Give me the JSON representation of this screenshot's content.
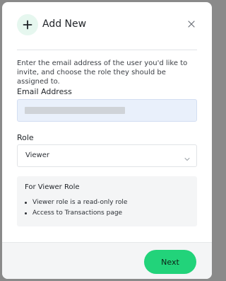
{
  "dialog": {
    "title": "Add New",
    "description": "Enter the email address of the user you'd like to invite, and choose the role they should be assigned to."
  },
  "email": {
    "label": "Email Address",
    "value": ""
  },
  "role": {
    "label": "Role",
    "selected": "Viewer"
  },
  "info": {
    "title": "For Viewer Role",
    "items": [
      "Viewer role is a read-only role",
      "Access to Transactions page"
    ]
  },
  "footer": {
    "next_label": "Next"
  },
  "colors": {
    "accent": "#22d37a",
    "accent_light": "#e6f7ef",
    "input_fill": "#e9f0fb",
    "info_fill": "#f4f5f6"
  },
  "icons": {
    "header": "plus-icon",
    "close": "close-icon",
    "select": "chevron-down-icon"
  }
}
